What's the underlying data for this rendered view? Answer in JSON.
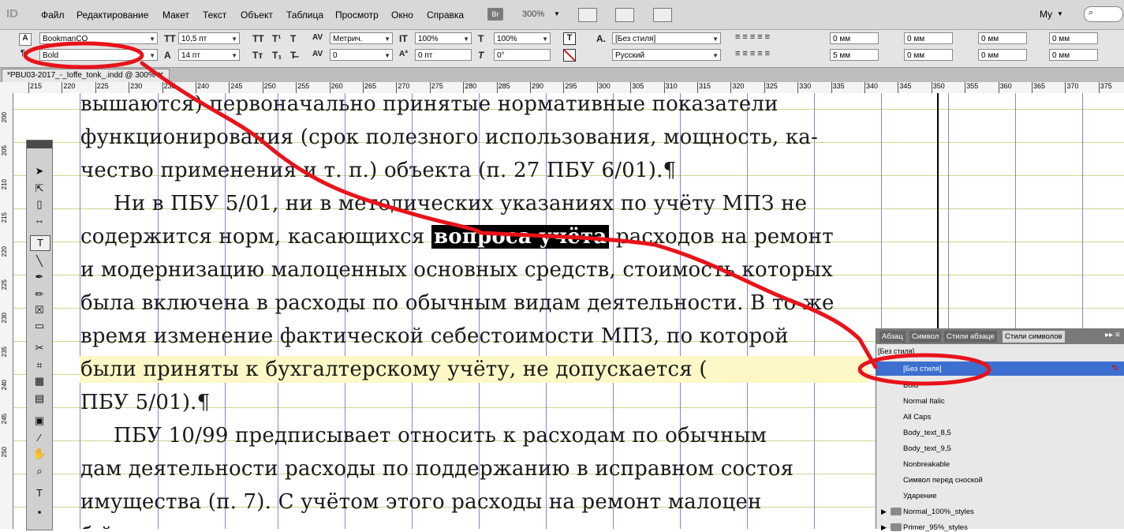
{
  "menubar": {
    "app_logo": "ID",
    "items": [
      "Файл",
      "Редактирование",
      "Макет",
      "Текст",
      "Объект",
      "Таблица",
      "Просмотр",
      "Окно",
      "Справка"
    ],
    "bridge": "Br",
    "zoom": "300%",
    "workspace": "Мy"
  },
  "control": {
    "font_family": "BookmanCO",
    "font_style": "Bold",
    "font_size": "10,5 пт",
    "leading": "14 пт",
    "kerning": "Метрич.",
    "tracking": "0",
    "vscale": "100%",
    "hscale": "100%",
    "baseline": "0 пт",
    "skew": "0°",
    "char_style": "[Без стиля]",
    "language": "Русский",
    "indent_left": "0 мм",
    "indent_first": "0 мм",
    "space_before": "0 мм",
    "space_after": "5 мм",
    "indent_right": "0 мм",
    "space_after2": "0 мм",
    "drop_lines": "0 мм",
    "drop_chars": "0 мм"
  },
  "doc_tab": "*PBU03-2017_-_Ioffe_tonk_.indd @ 300%",
  "ruler": {
    "h": [
      "215",
      "220",
      "225",
      "230",
      "235",
      "240",
      "245",
      "250",
      "255",
      "260",
      "265",
      "270",
      "275",
      "280",
      "285",
      "290",
      "295",
      "300",
      "305",
      "310",
      "315",
      "320",
      "325",
      "330",
      "335",
      "340",
      "345",
      "350",
      "355",
      "360",
      "365",
      "370",
      "375"
    ],
    "v": [
      "200",
      "205",
      "210",
      "215",
      "220",
      "225",
      "230",
      "235",
      "240",
      "245",
      "250"
    ]
  },
  "text": {
    "l1": "вышаются) первоначально принятые нормативные показатели",
    "l2": "функционирования (срок полезного использования, мощность, ка-",
    "l3": "чество применения и т. п.) объекта (п. 27 ПБУ 6/01).¶",
    "l4": "Ни в ПБУ 5/01, ни в методических указаниях по учёту МПЗ не",
    "l5a": "содержится норм, касающихся ",
    "l5b": "вопроса учёта",
    "l5c": " расходов на ремонт",
    "l6": "и модернизацию малоценных основных средств, стоимость которых",
    "l7": "была включена в расходы по обычным видам деятельности. В то же",
    "l8": "время изменение фактической себестоимости МПЗ, по которой",
    "l9": "были приняты к бухгалтерскому учёту, не допускается (",
    "l10": "ПБУ 5/01).¶",
    "l11": "ПБУ 10/99 предписывает относить к расходам по обычным",
    "l12": "дам деятельности расходы по поддержанию в исправном состоя",
    "l13": "имущества (п. 7). С учётом этого расходы на ремонт малоцен",
    "l14": "                    б             й"
  },
  "panel": {
    "tabs": [
      "Абзац",
      "Символ",
      "Стили абзаце",
      "Стили символов"
    ],
    "header": "[Без стиля]",
    "items": [
      "[Без стиля]",
      "Bold",
      "Normal Italic",
      "All Caps",
      "Body_text_8,5",
      "Body_text_9,5",
      "Nonbreakable",
      "Символ перед сноской",
      "Ударение",
      "Normal_100%_styles",
      "Primer_95%_styles"
    ]
  },
  "colors": {
    "annotation": "#e8131a",
    "selection": "#3c6fd0",
    "guide_h": "#c8d890",
    "guide_v": "#9a7ad8",
    "highlight": "#fdf8c6"
  }
}
